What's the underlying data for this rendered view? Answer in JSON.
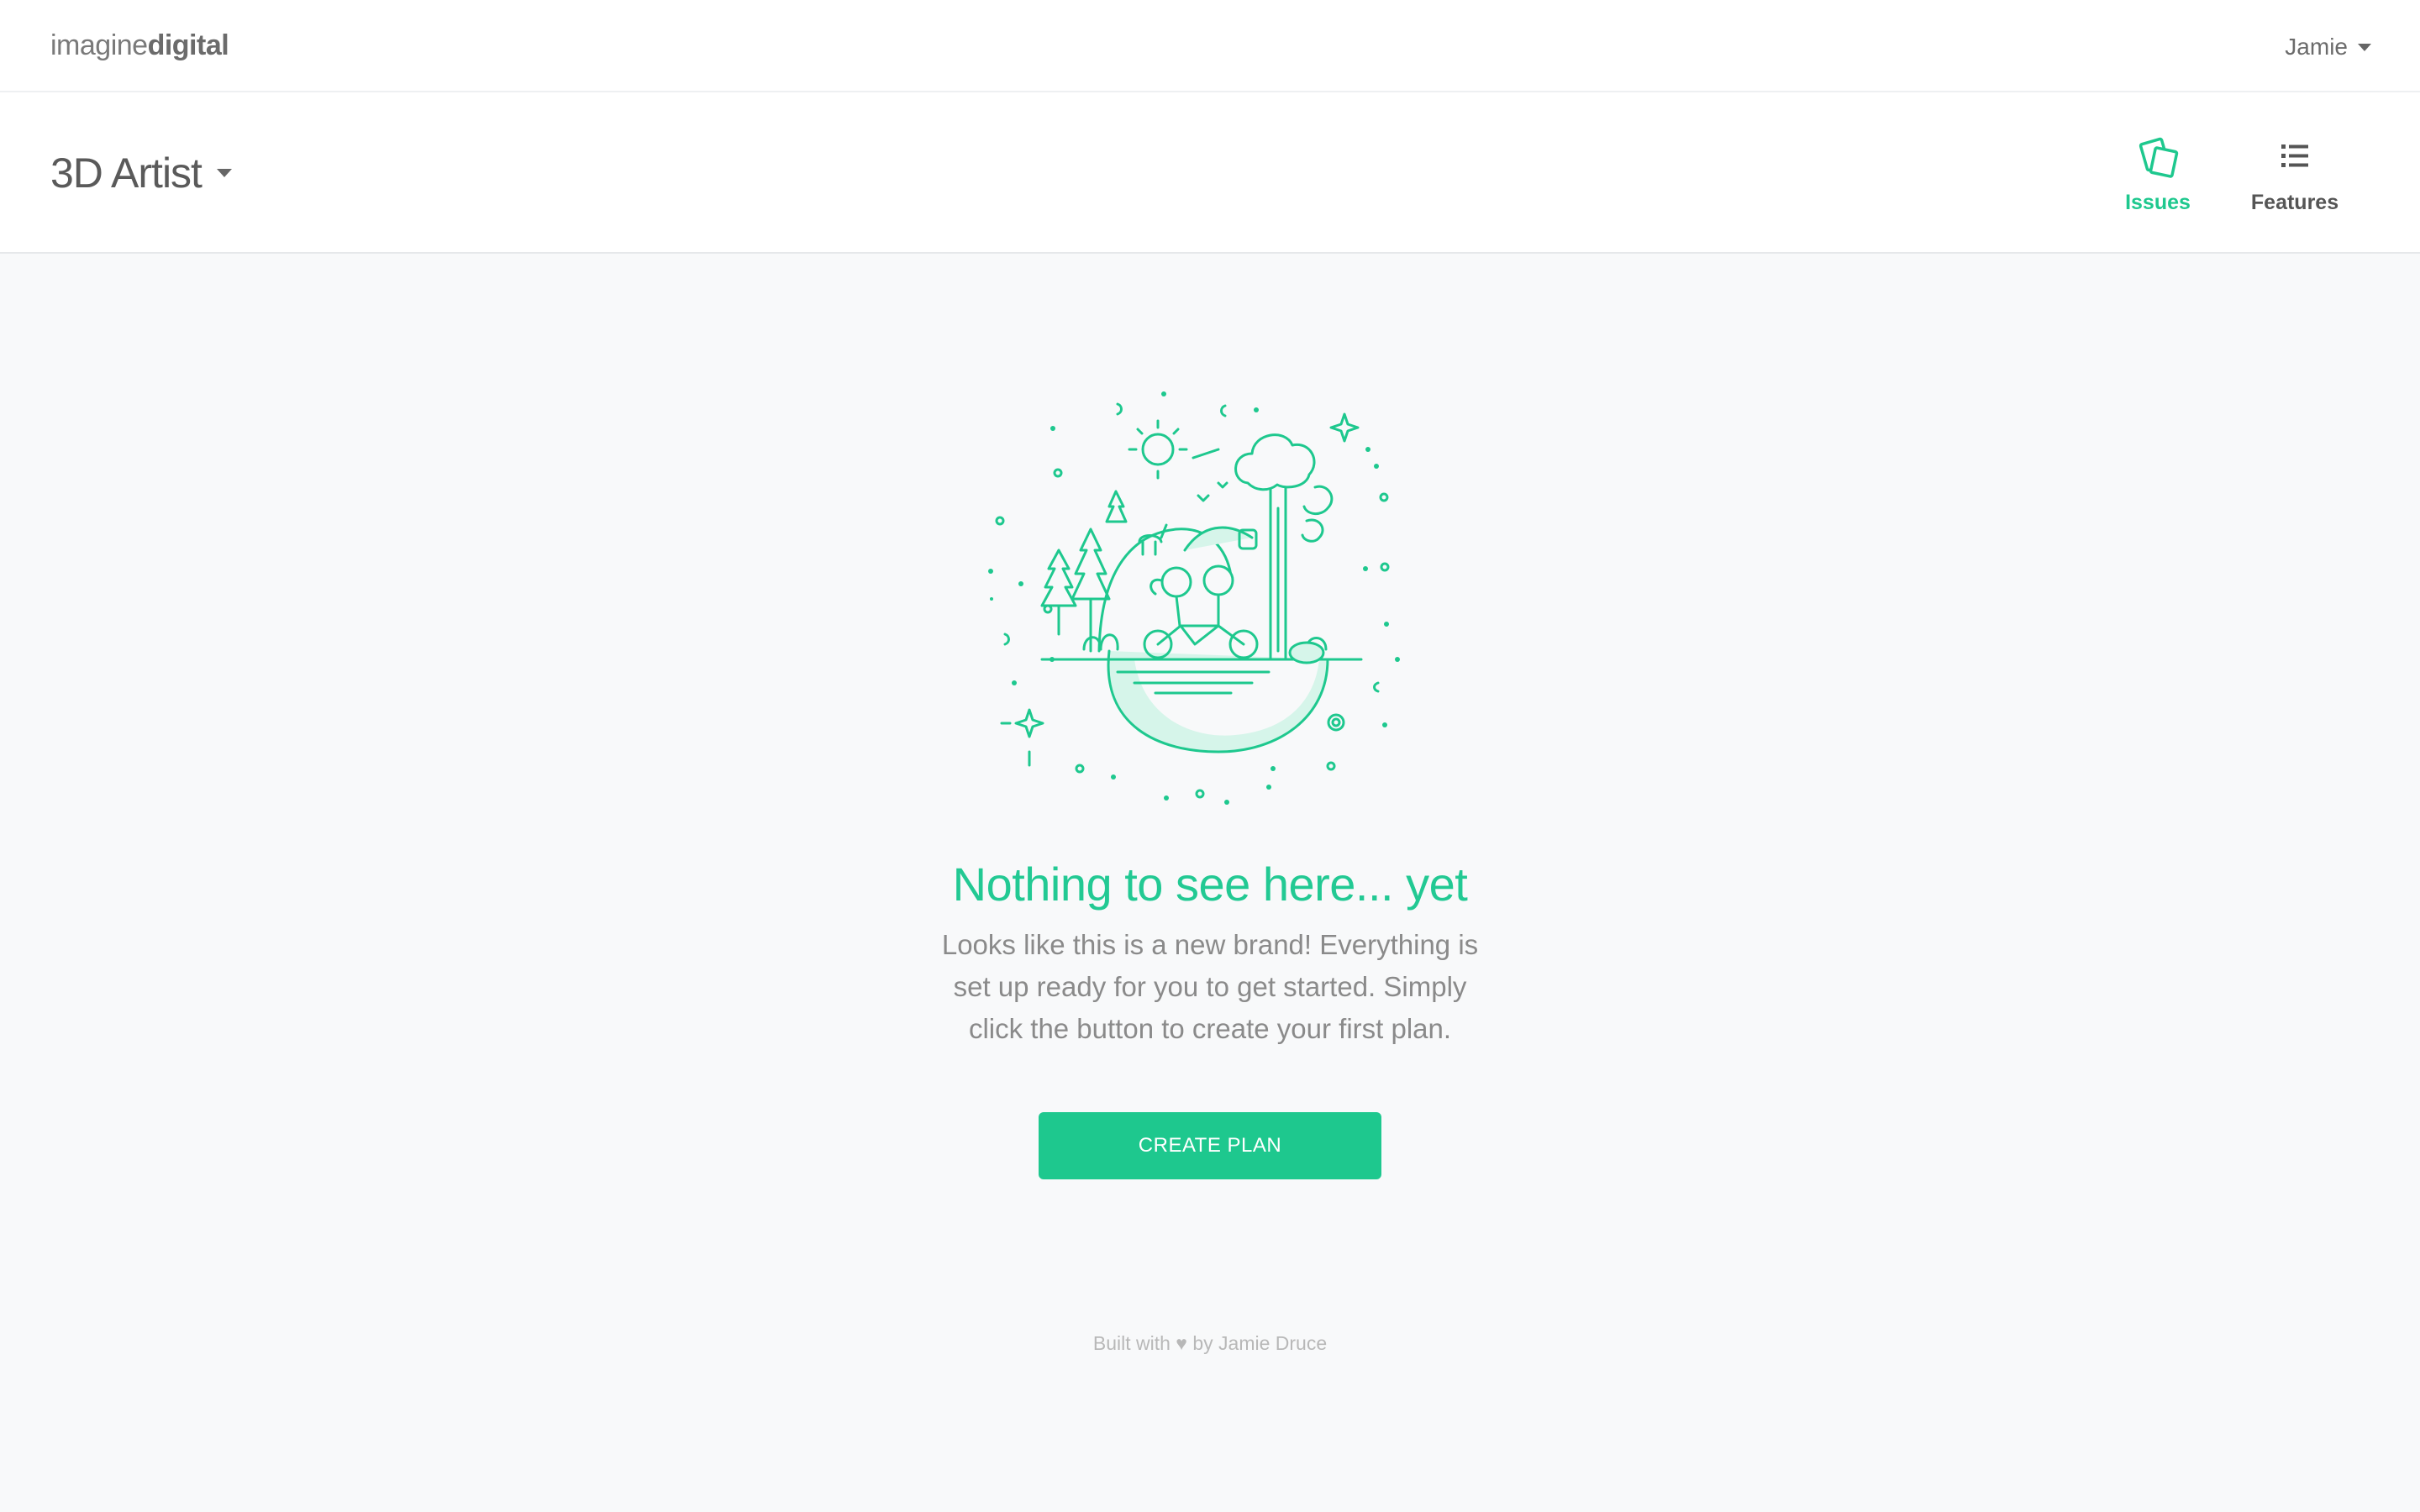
{
  "topbar": {
    "logo_light": "imagine",
    "logo_bold": "digital",
    "user_name": "Jamie"
  },
  "project": {
    "title": "3D Artist"
  },
  "tabs": [
    {
      "label": "Issues",
      "icon": "issues-cards-icon",
      "active": true
    },
    {
      "label": "Features",
      "icon": "list-icon",
      "active": false
    }
  ],
  "empty_state": {
    "illustration": "tandem-bike-nature-illustration",
    "title": "Nothing to see here... yet",
    "text": "Looks like this is a new brand! Everything is set up ready for you to get started. Simply click the button to create your first plan.",
    "button_label": "CREATE PLAN"
  },
  "footer": {
    "before": "Built with",
    "heart": "♥",
    "after": "by Jamie Druce"
  },
  "colors": {
    "accent": "#1ec88e",
    "background": "#f8f9fa",
    "header": "#ffffff",
    "muted_text": "#8a8a8a"
  }
}
